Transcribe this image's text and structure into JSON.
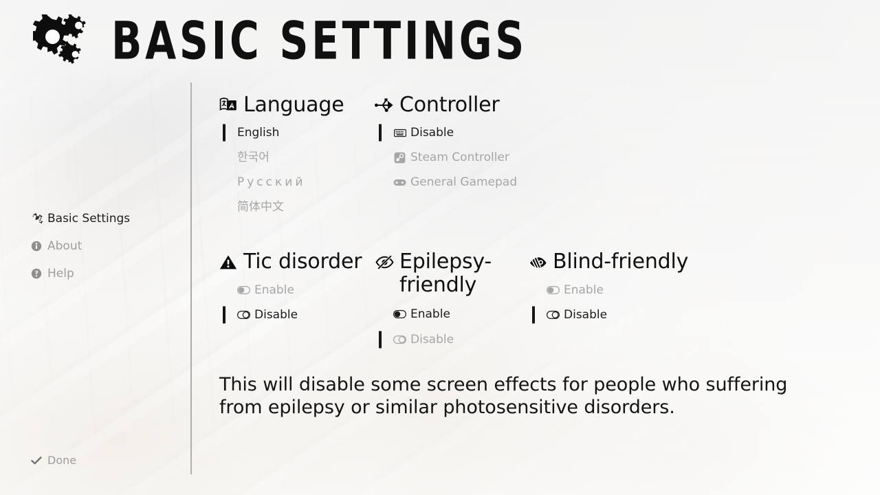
{
  "window": {
    "title": "BASIC SETTINGS",
    "logo_icon": "gears-icon",
    "background_accent": "#f1f1f0"
  },
  "sidebar": {
    "items": [
      {
        "id": "basic-settings",
        "label": "Basic Settings",
        "icon": "cogs-icon",
        "state": "active"
      },
      {
        "id": "about",
        "label": "About",
        "icon": "info-circle-icon",
        "state": "inactive"
      },
      {
        "id": "help",
        "label": "Help",
        "icon": "question-circle-icon",
        "state": "inactive"
      }
    ],
    "done": {
      "label": "Done",
      "icon": "check-icon"
    }
  },
  "main": {
    "groups": [
      {
        "id": "language",
        "title": "Language",
        "icon": "language-icon",
        "options": [
          {
            "label": "English",
            "icon": null,
            "selected": true,
            "highlighted": true
          },
          {
            "label": "한국어",
            "icon": null,
            "selected": false,
            "highlighted": false
          },
          {
            "label": "Русский",
            "icon": null,
            "selected": false,
            "highlighted": false,
            "letterspaced": true
          },
          {
            "label": "简体中文",
            "icon": null,
            "selected": false,
            "highlighted": false
          }
        ]
      },
      {
        "id": "controller",
        "title": "Controller",
        "icon": "usb-icon",
        "options": [
          {
            "label": "Disable",
            "icon": "keyboard-icon",
            "selected": true,
            "highlighted": true
          },
          {
            "label": "Steam Controller",
            "icon": "steam-icon",
            "selected": false,
            "highlighted": false
          },
          {
            "label": "General Gamepad",
            "icon": "gamepad-icon",
            "selected": false,
            "highlighted": false
          }
        ]
      },
      {
        "id": "tic-disorder",
        "title": "Tic disorder",
        "icon": "warning-triangle-icon",
        "options": [
          {
            "label": "Enable",
            "icon": "toggle-on-icon",
            "selected": false,
            "highlighted": false
          },
          {
            "label": "Disable",
            "icon": "toggle-off-icon",
            "selected": true,
            "highlighted": true
          }
        ]
      },
      {
        "id": "epilepsy-friendly",
        "title": "Epilepsy-friendly",
        "icon": "eye-slash-icon",
        "options": [
          {
            "label": "Enable",
            "icon": "toggle-on-icon",
            "selected": false,
            "highlighted": true
          },
          {
            "label": "Disable",
            "icon": "toggle-off-icon",
            "selected": true,
            "highlighted": false
          }
        ]
      },
      {
        "id": "blind-friendly",
        "title": "Blind-friendly",
        "icon": "low-vision-icon",
        "options": [
          {
            "label": "Enable",
            "icon": "toggle-on-icon",
            "selected": false,
            "highlighted": false
          },
          {
            "label": "Disable",
            "icon": "toggle-off-icon",
            "selected": true,
            "highlighted": true
          }
        ]
      }
    ],
    "description": "This will disable some screen effects for people who suffering from epilepsy or similar photosensitive disorders."
  }
}
